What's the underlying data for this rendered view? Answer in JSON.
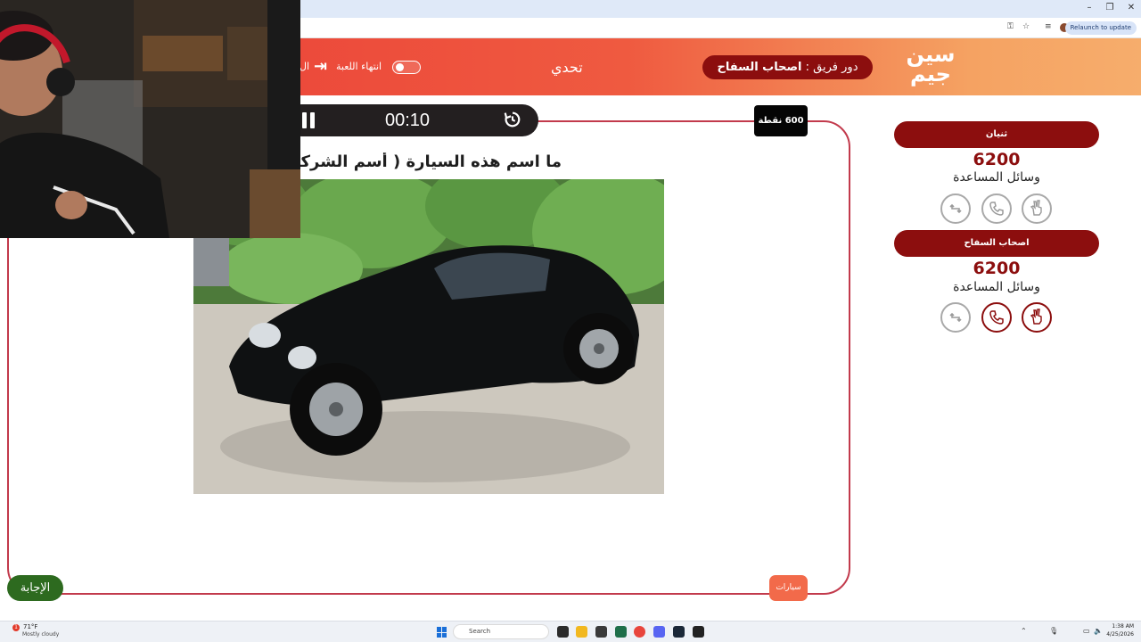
{
  "browser": {
    "relaunch_label": "Relaunch to update"
  },
  "header": {
    "logo_line1": "سين",
    "logo_line2": "جيم",
    "turn_prefix": "دور فريق :",
    "turn_team": "اصحاب السفاح",
    "challenge_label": "تحدي",
    "end_game_label": "انتهاء اللعبة",
    "cut_letter": "ال"
  },
  "game": {
    "timer": "00:10",
    "points": "600 نقطة",
    "question": "ما اسم هذه السيارة ( أسم الشركة ) ؟",
    "category": "سيارات",
    "answer_label": "الإجابة"
  },
  "teams": [
    {
      "name": "ثنيان",
      "score": "6200",
      "helpers_label": "وسائل المساعدة",
      "lifelines": [
        {
          "icon": "double-answer-icon",
          "active": false
        },
        {
          "icon": "phone-icon",
          "active": false
        },
        {
          "icon": "two-answers-hand-icon",
          "active": false
        }
      ]
    },
    {
      "name": "اصحاب السفاح",
      "score": "6200",
      "helpers_label": "وسائل المساعدة",
      "lifelines": [
        {
          "icon": "double-answer-icon",
          "active": false
        },
        {
          "icon": "phone-icon",
          "active": true
        },
        {
          "icon": "two-answers-hand-icon",
          "active": true
        }
      ]
    }
  ],
  "taskbar": {
    "weather_temp": "71°F",
    "weather_desc": "Mostly cloudy",
    "search_placeholder": "Search",
    "time": "1:38 AM",
    "date": "4/25/2026"
  },
  "colors": {
    "brand_red": "#8c0e0e",
    "frame_border": "#c23a4c",
    "answer_green": "#2d6a1f",
    "category_orange": "#f26a4a"
  }
}
